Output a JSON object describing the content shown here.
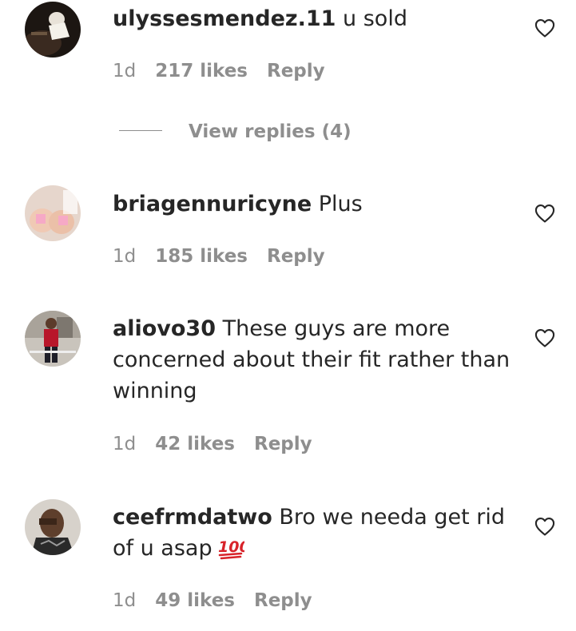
{
  "comments": [
    {
      "username": "ulyssesmendez.11",
      "text": "u sold",
      "time": "1d",
      "likes": "217 likes",
      "reply": "Reply",
      "view_replies": "View replies (4)"
    },
    {
      "username": "briagennuricyne",
      "text": "Plus",
      "time": "1d",
      "likes": "185 likes",
      "reply": "Reply"
    },
    {
      "username": "aliovo30",
      "text": "These guys are more concerned about their fit rather than winning",
      "time": "1d",
      "likes": "42 likes",
      "reply": "Reply"
    },
    {
      "username": "ceefrmdatwo",
      "text": "Bro we needa get rid of u asap",
      "emoji": "💯",
      "time": "1d",
      "likes": "49 likes",
      "reply": "Reply"
    }
  ],
  "icons": {
    "like": "heart-outline-icon",
    "emoji": "hundred-points-emoji"
  },
  "colors": {
    "text": "#262626",
    "secondary": "#8e8e8e",
    "emoji_red": "#d8232a"
  }
}
